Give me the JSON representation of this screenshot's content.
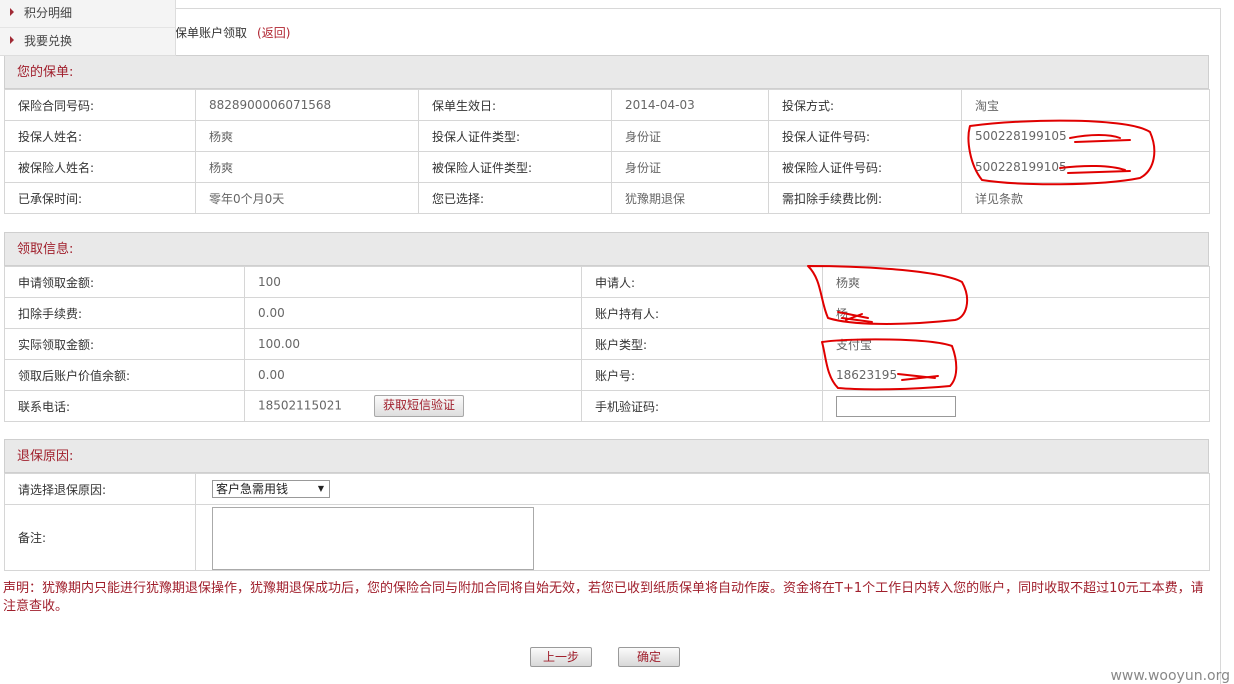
{
  "side_menu": {
    "items": [
      {
        "label": "积分明细"
      },
      {
        "label": "我要兑换"
      }
    ]
  },
  "breadcrumb": {
    "text": "保单账户领取",
    "back_label": "(返回)"
  },
  "policy_section": {
    "title": "您的保单:",
    "rows": [
      {
        "l1": "保险合同号码:",
        "v1": "8828900006071568",
        "l2": "保单生效日:",
        "v2": "2014-04-03",
        "l3": "投保方式:",
        "v3": "淘宝"
      },
      {
        "l1": "投保人姓名:",
        "v1": "杨爽",
        "l2": "投保人证件类型:",
        "v2": "身份证",
        "l3": "投保人证件号码:",
        "v3": "500228199105"
      },
      {
        "l1": "被保险人姓名:",
        "v1": "杨爽",
        "l2": "被保险人证件类型:",
        "v2": "身份证",
        "l3": "被保险人证件号码:",
        "v3": "500228199105"
      },
      {
        "l1": "已承保时间:",
        "v1": "零年0个月0天",
        "l2": "您已选择:",
        "v2": "犹豫期退保",
        "l3": "需扣除手续费比例:",
        "v3": "详见条款"
      }
    ]
  },
  "claim_section": {
    "title": "领取信息:",
    "rows": [
      {
        "l1": "申请领取金额:",
        "v1": "100",
        "l2": "申请人:",
        "v2": "杨爽"
      },
      {
        "l1": "扣除手续费:",
        "v1": "0.00",
        "l2": "账户持有人:",
        "v2": "杨"
      },
      {
        "l1": "实际领取金额:",
        "v1": "100.00",
        "l2": "账户类型:",
        "v2": "支付宝"
      },
      {
        "l1": "领取后账户价值余额:",
        "v1": "0.00",
        "l2": "账户号:",
        "v2": "18623195"
      },
      {
        "l1": "联系电话:",
        "v1": "18502115021",
        "l2": "手机验证码:",
        "v2": ""
      }
    ],
    "sms_button_label": "获取短信验证",
    "sms_code_value": ""
  },
  "reason_section": {
    "title": "退保原因:",
    "select_label": "请选择退保原因:",
    "select_value": "客户急需用钱",
    "remark_label": "备注:",
    "remark_value": ""
  },
  "notice": "声明：犹豫期内只能进行犹豫期退保操作，犹豫期退保成功后，您的保险合同与附加合同将自始无效，若您已收到纸质保单将自动作废。资金将在T+1个工作日内转入您的账户，同时收取不超过10元工本费，请注意查收。",
  "buttons": {
    "prev_label": "上一步",
    "confirm_label": "确定"
  },
  "watermark": "www.wooyun.org",
  "colors": {
    "accent": "#a01f2c",
    "header_bg": "#e9e9e9",
    "border": "#d6d6d6",
    "annotation": "#e00000"
  }
}
